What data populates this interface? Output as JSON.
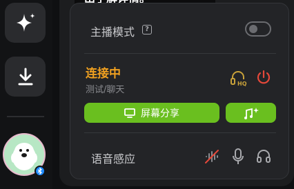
{
  "tooltip": {
    "text": "出了解详情。"
  },
  "sidebar": {
    "items": [
      {
        "name": "sparkle-icon"
      },
      {
        "name": "download-icon"
      }
    ],
    "avatar": {
      "badge": "bluetooth-icon"
    }
  },
  "panel": {
    "anchor_mode": {
      "label": "主播模式",
      "help": "?",
      "enabled": false
    },
    "connection": {
      "status": "连接中",
      "mode": "测试/聊天",
      "status_color": "#f0a020"
    },
    "actions": {
      "share_screen": "屏幕分享",
      "share_icon": "monitor-icon",
      "effects_icon": "music-sparkle-icon"
    },
    "voice": {
      "label": "语音感应"
    }
  },
  "colors": {
    "accent_green": "#6abf1f",
    "power_red": "#e5483a",
    "hq_gold": "#c9a23a"
  }
}
